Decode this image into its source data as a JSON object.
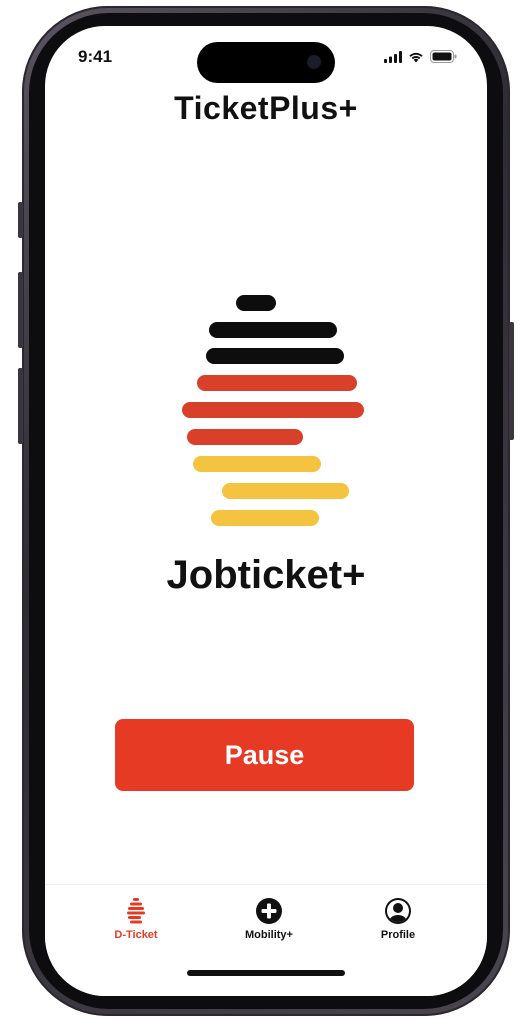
{
  "status_bar": {
    "time": "9:41",
    "icons": [
      "signal-icon",
      "wifi-icon",
      "battery-icon"
    ]
  },
  "header": {
    "app_title": "TicketPlus+"
  },
  "logo": {
    "icon": "germany-stripes-logo-icon",
    "colors": {
      "black": "#0d0d0d",
      "red": "#d8402a",
      "gold": "#f4c340"
    }
  },
  "product": {
    "name": "Jobticket+"
  },
  "actions": {
    "pause_label": "Pause",
    "accent": "#e63a24"
  },
  "tab_bar": {
    "active_index": 0,
    "tabs": [
      {
        "label": "D-Ticket",
        "icon": "d-ticket-stripes-icon"
      },
      {
        "label": "Mobility+",
        "icon": "plus-circle-icon"
      },
      {
        "label": "Profile",
        "icon": "profile-icon"
      }
    ]
  }
}
